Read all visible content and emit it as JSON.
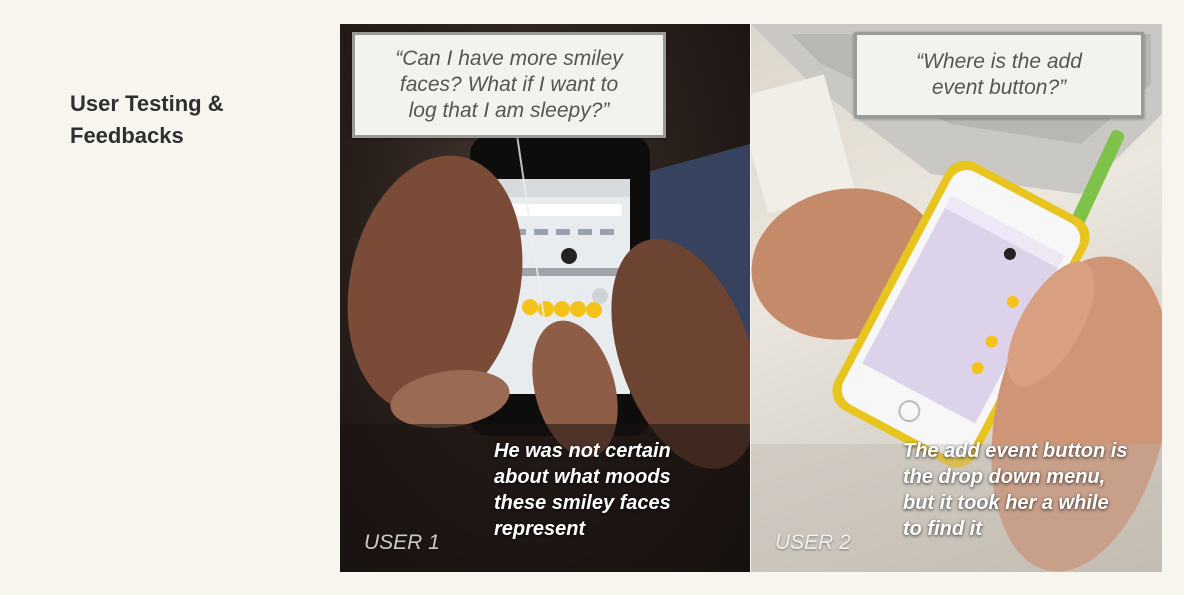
{
  "heading": "User Testing &\nFeedbacks",
  "panels": [
    {
      "quote": "“Can I have more smiley\nfaces? What if I want to\nlog that I am sleepy?”",
      "caption": "He was not certain\nabout what moods\nthese smiley faces\nrepresent",
      "user_label": "USER 1"
    },
    {
      "quote": "“Where is the add\nevent button?”",
      "caption": "The add event button is\nthe drop down menu,\nbut it took her a while\nto find it",
      "user_label": "USER 2"
    }
  ]
}
